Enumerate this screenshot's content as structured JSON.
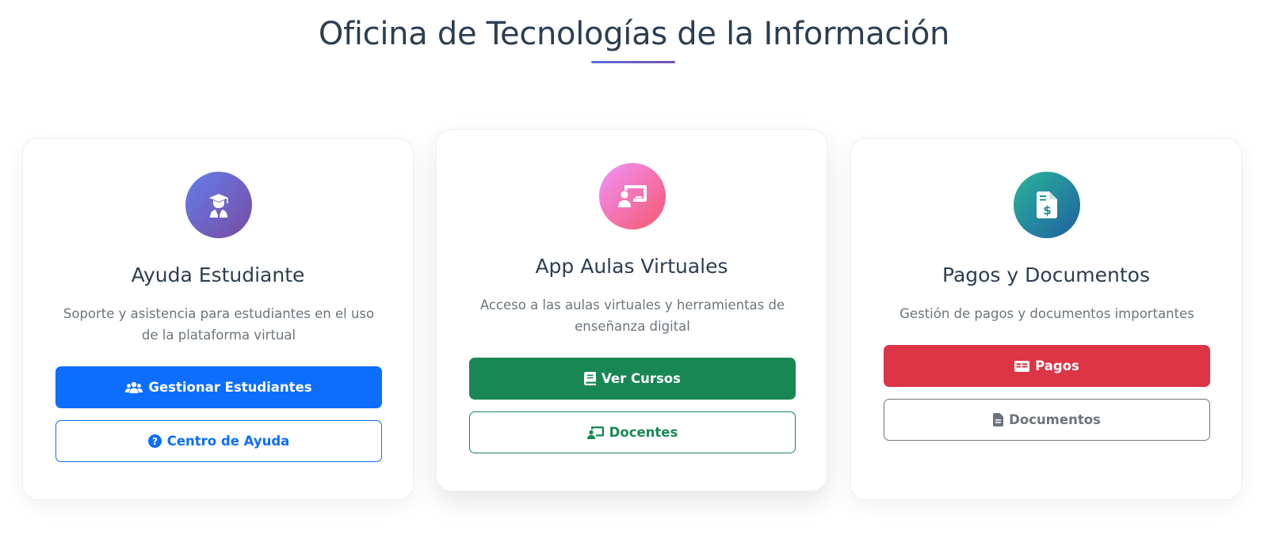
{
  "page": {
    "title": "Oficina de Tecnologías de la Información"
  },
  "cards": [
    {
      "title": "Ayuda Estudiante",
      "description": "Soporte y asistencia para estudiantes en el uso de la plataforma virtual",
      "icon": "user-graduate-icon",
      "primary_button": {
        "label": "Gestionar Estudiantes",
        "icon": "users-icon"
      },
      "secondary_button": {
        "label": "Centro de Ayuda",
        "icon": "question-circle-icon"
      }
    },
    {
      "title": "App Aulas Virtuales",
      "description": "Acceso a las aulas virtuales y herramientas de enseñanza digital",
      "icon": "chalkboard-user-icon",
      "primary_button": {
        "label": "Ver Cursos",
        "icon": "book-icon"
      },
      "secondary_button": {
        "label": "Docentes",
        "icon": "chalkboard-teacher-icon"
      }
    },
    {
      "title": "Pagos y Documentos",
      "description": "Gestión de pagos y documentos importantes",
      "icon": "file-invoice-dollar-icon",
      "primary_button": {
        "label": "Pagos",
        "icon": "money-bill-icon"
      },
      "secondary_button": {
        "label": "Documentos",
        "icon": "file-alt-icon"
      }
    }
  ],
  "colors": {
    "title": "#2c3e50",
    "primary": "#0d6efd",
    "success": "#198754",
    "danger": "#dc3545",
    "secondary": "#6c757d",
    "muted_text": "#6c757d"
  }
}
